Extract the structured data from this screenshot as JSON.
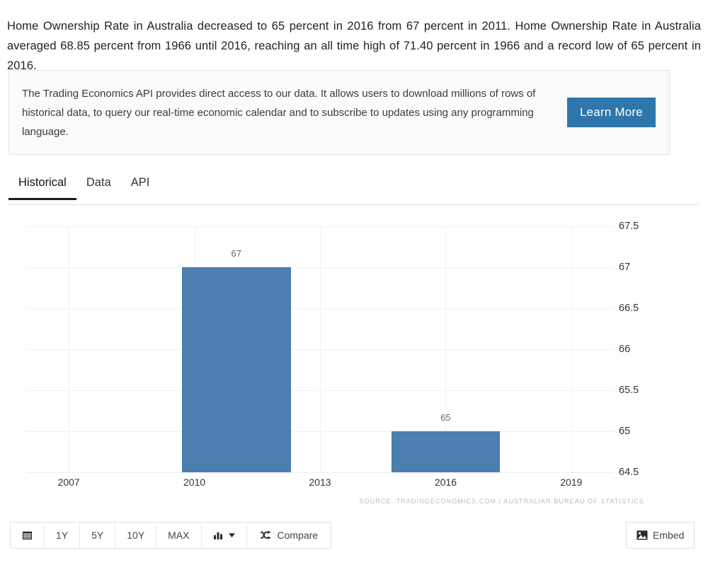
{
  "intro": {
    "paragraph": "Home Ownership Rate in Australia decreased to 65 percent in 2016 from 67 percent in 2011. Home Ownership Rate in Australia averaged 68.85 percent from 1966 until 2016, reaching an all time high of 71.40 percent in 1966 and a record low of 65 percent in 2016."
  },
  "promo": {
    "text": "The Trading Economics API provides direct access to our data. It allows users to download millions of rows of historical data, to query our real-time economic calendar and to subscribe to updates using any programming language.",
    "button_label": "Learn More",
    "button_color": "#2e76ab"
  },
  "tabs": [
    {
      "label": "Historical",
      "active": true
    },
    {
      "label": "Data",
      "active": false
    },
    {
      "label": "API",
      "active": false
    }
  ],
  "chart_data": {
    "type": "bar",
    "title": "",
    "subtitle": "",
    "xlabel": "",
    "ylabel": "",
    "categories": [
      "2011",
      "2016"
    ],
    "values": [
      67,
      65
    ],
    "data_labels": [
      "67",
      "65"
    ],
    "x_positions": [
      2011,
      2016
    ],
    "ylim": [
      64.5,
      67.5
    ],
    "xlim": [
      2006,
      2020
    ],
    "y_ticks": [
      "67.5",
      "67",
      "66.5",
      "66",
      "65.5",
      "65",
      "64.5"
    ],
    "y_tick_values": [
      67.5,
      67,
      66.5,
      66,
      65.5,
      65,
      64.5
    ],
    "x_ticks": [
      "2007",
      "2010",
      "2013",
      "2016",
      "2019"
    ],
    "x_tick_values": [
      2007,
      2010,
      2013,
      2016,
      2019
    ],
    "grid": true,
    "legend": false,
    "bar_color": "#4a7fb0",
    "units": "percent",
    "source": "SOURCE: TRADINGECONOMICS.COM  |  AUSTRALIAN BUREAU OF STATISTICS"
  },
  "toolbar": {
    "calendar_icon": "calendar-icon",
    "ranges": [
      "1Y",
      "5Y",
      "10Y",
      "MAX"
    ],
    "chart_type_icon": "bar-chart-icon",
    "chart_type_caret": "chevron-down-icon",
    "compare_icon": "shuffle-icon",
    "compare_label": "Compare",
    "embed_icon": "image-icon",
    "embed_label": "Embed"
  }
}
